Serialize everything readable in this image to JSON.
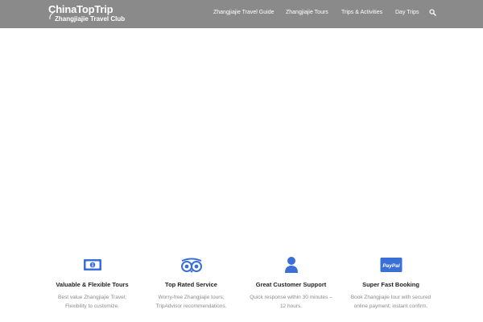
{
  "header": {
    "logo": {
      "main": "ChinaTopTrip",
      "sub": "Zhangjiajie Travel Club"
    },
    "nav": [
      {
        "label": "Zhangjiajie Travel Guide"
      },
      {
        "label": "Zhangjiajie Tours"
      },
      {
        "label": "Trips & Activities"
      },
      {
        "label": "Day Trips"
      }
    ],
    "search_icon": "search-icon"
  },
  "features": [
    {
      "icon": "money-bill-icon",
      "title": "Valuable & Flexible Tours",
      "desc_line1": "Best value Zhangjiajie Travel;",
      "desc_line2": "Flexibility to customize."
    },
    {
      "icon": "tripadvisor-owl-icon",
      "title": "Top Rated Service",
      "desc_line1": "Worry-free Zhangjiajie tours;",
      "desc_line2": "TripAdvisor recommendations."
    },
    {
      "icon": "user-icon",
      "title": "Great Customer Support",
      "desc_line1": "Quick response within 30 minutes –",
      "desc_line2": "12 hours."
    },
    {
      "icon": "paypal-icon",
      "icon_text": "PayPal",
      "title": "Super Fast Booking",
      "desc_line1": "Book Zhangjiajie tour with secured",
      "desc_line2": "online payment; instant confirm."
    }
  ],
  "colors": {
    "header_bg": "#8a8a8a",
    "icon_blue": "#3a6fd8",
    "title_text": "#222222",
    "desc_text": "#8a8a8a"
  }
}
